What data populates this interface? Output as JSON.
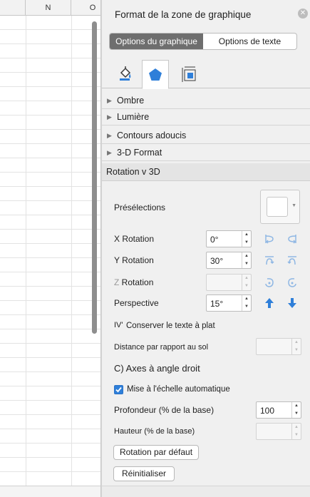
{
  "sheet": {
    "columns": [
      "",
      "N",
      "O"
    ]
  },
  "pane": {
    "title": "Format de la zone de graphique",
    "segments": [
      {
        "label": "Options du graphique",
        "active": true
      },
      {
        "label": "Options de texte",
        "active": false
      }
    ],
    "icon_tabs": [
      "fill-line-icon",
      "effects-pentagon-icon",
      "size-properties-icon"
    ],
    "sections": [
      {
        "label": "Ombre"
      },
      {
        "label": "Lumière"
      },
      {
        "label": "Contours adoucis"
      },
      {
        "label": "3-D Format"
      }
    ],
    "rotation": {
      "header": "Rotation v 3D",
      "presets_label": "Présélections",
      "x_label": "X Rotation",
      "x_value": "0°",
      "y_label": "Y Rotation",
      "y_value": "30°",
      "z_label_letter": "Z",
      "z_label_rest": " Rotation",
      "z_value": "",
      "perspective_label": "Perspective",
      "perspective_value": "15°",
      "keep_text_flat_prefix": "IV'",
      "keep_text_flat_label": "Conserver le texte à plat",
      "keep_text_flat_checked": false,
      "distance_label": "Distance par rapport au sol",
      "distance_value": "",
      "right_angle_label": "C) Axes à angle droit",
      "autoscale_label": "Mise à l'échelle automatique",
      "autoscale_checked": true,
      "depth_label": "Profondeur (% de la base)",
      "depth_value": "100",
      "height_label": "Hauteur (% de la base)",
      "height_value": "",
      "default_rotation_button": "Rotation par défaut",
      "reset_button": "Réinitialiser"
    }
  },
  "colors": {
    "accent": "#2f7fd9",
    "segment_active": "#6e6e6e"
  }
}
